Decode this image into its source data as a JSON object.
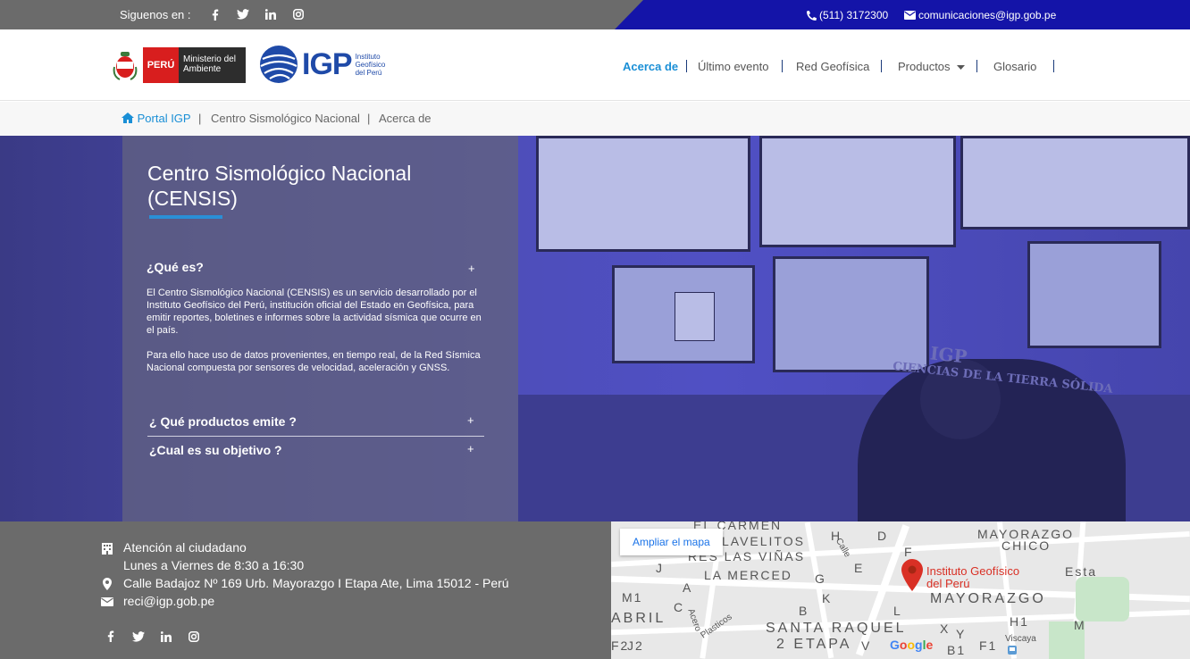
{
  "topbar": {
    "follow_label": "Siguenos en :",
    "social": [
      "facebook-icon",
      "twitter-icon",
      "linkedin-icon",
      "instagram-icon"
    ],
    "phone": "(511) 3172300",
    "email": "comunicaciones@igp.gob.pe"
  },
  "header": {
    "peru_logo_text": "PERÚ",
    "ministry_text": "Ministerio del Ambiente",
    "igp_logo_text": "IGP",
    "igp_logo_sub": "Instituto Geofísico del Perú",
    "nav": [
      {
        "label": "Acerca de",
        "active": true
      },
      {
        "label": "Último evento",
        "active": false
      },
      {
        "label": "Red Geofísica",
        "active": false
      },
      {
        "label": "Productos",
        "active": false,
        "dropdown": true
      },
      {
        "label": "Glosario",
        "active": false
      }
    ]
  },
  "breadcrumb": {
    "items": [
      "Portal IGP",
      "Centro Sismológico Nacional",
      "Acerca de"
    ]
  },
  "hero": {
    "title_line1": "Centro Sismológico Nacional",
    "title_line2": "(CENSIS)",
    "photo_text_1": "IGP",
    "photo_text_2": "CIENCIAS DE LA TIERRA SÓLIDA",
    "accordion": [
      {
        "title": "¿Qué es?",
        "expanded": true,
        "paragraphs": [
          "El Centro Sismológico Nacional (CENSIS) es un servicio desarrollado por el Instituto Geofísico del Perú, institución oficial del Estado en Geofísica, para emitir reportes, boletines e informes sobre la actividad sísmica que ocurre en el país.",
          "Para ello hace uso de datos provenientes, en tiempo real, de la Red Sísmica Nacional compuesta por sensores de velocidad, aceleración y GNSS."
        ]
      },
      {
        "title": "¿ Qué productos emite ?",
        "expanded": false
      },
      {
        "title": "¿Cual es su objetivo ?",
        "expanded": false
      }
    ],
    "plus": "+"
  },
  "footer": {
    "attention": "Atención al ciudadano",
    "hours": "Lunes a Viernes de 8:30 a 16:30",
    "address": "Calle Badajoz Nº 169 Urb. Mayorazgo I Etapa Ate, Lima 15012 - Perú",
    "email": "reci@igp.gob.pe",
    "social": [
      "facebook-icon",
      "twitter-icon",
      "linkedin-icon",
      "instagram-icon"
    ]
  },
  "map": {
    "enlarge_label": "Ampliar el mapa",
    "place_label_1": "Instituto Geofísico",
    "place_label_2": "del Perú",
    "labels": {
      "carmen": "EL CARMEN",
      "avelitos": "LAVELITOS",
      "vinas": "RES LAS VIÑAS",
      "merced": "LA MERCED",
      "mayorazgo_chico_1": "MAYORAZGO",
      "mayorazgo_chico_2": "CHICO",
      "mayorazgo": "MAYORAZGO",
      "abril": "ABRIL",
      "santa_raquel": "SANTA RAQUEL",
      "etapa": "2 ETAPA",
      "calle": "Calle",
      "acero": "Acero",
      "plasticos": "Plasticos",
      "viscaya": "Viscaya",
      "esta": "Esta"
    },
    "grid_letters": [
      "M1",
      "J2",
      "F2",
      "J",
      "A",
      "C",
      "D",
      "E",
      "F",
      "H",
      "K",
      "L",
      "B",
      "G",
      "X",
      "Y",
      "V",
      "H1",
      "B1",
      "F1",
      "M"
    ],
    "brand": "Google",
    "brand_colors": [
      "#4285F4",
      "#EA4335",
      "#FBBC05",
      "#4285F4",
      "#34A853",
      "#EA4335"
    ]
  }
}
